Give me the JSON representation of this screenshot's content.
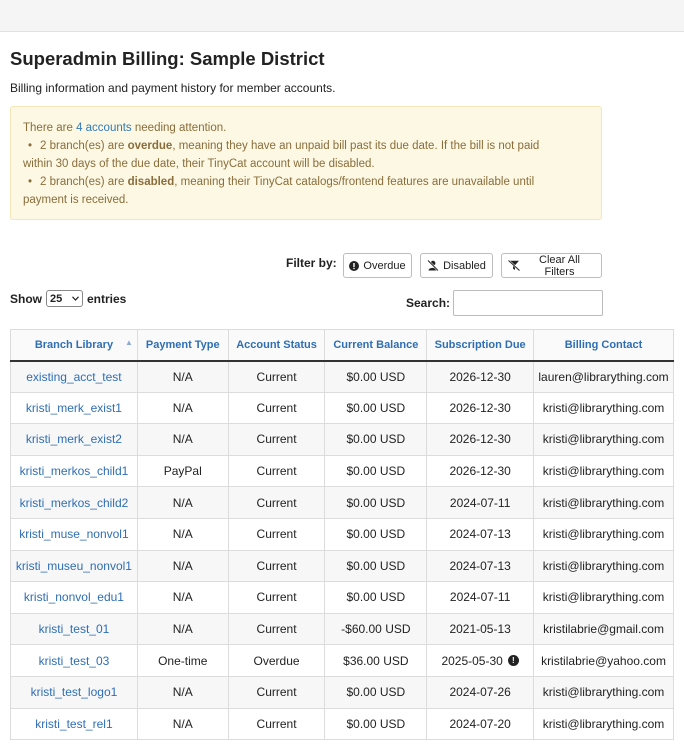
{
  "page": {
    "title": "Superadmin Billing: Sample District",
    "subtitle": "Billing information and payment history for member accounts."
  },
  "alert": {
    "intro_before": "There are ",
    "accounts_link": "4 accounts",
    "intro_after": " needing attention.",
    "overdue_count": "2 branch(es) are ",
    "overdue_word": "overdue",
    "overdue_rest_line1": ", meaning they have an unpaid bill past its due date. If the bill is not paid",
    "overdue_rest_line2": "within 30 days of the due date, their TinyCat account will be disabled.",
    "disabled_count": "2 branch(es) are ",
    "disabled_word": "disabled",
    "disabled_rest_line1": ", meaning their TinyCat catalogs/frontend features are unavailable until",
    "disabled_rest_line2": "payment is received."
  },
  "filters": {
    "label": "Filter by:",
    "overdue": "Overdue",
    "disabled": "Disabled",
    "clear": "Clear All Filters"
  },
  "entries": {
    "show": "Show",
    "value": "25",
    "suffix": "entries"
  },
  "search": {
    "label": "Search:",
    "value": ""
  },
  "table": {
    "headers": [
      "Branch Library",
      "Payment Type",
      "Account Status",
      "Current Balance",
      "Subscription Due",
      "Billing Contact"
    ],
    "rows": [
      {
        "branch": "existing_acct_test",
        "payment": "N/A",
        "status": "Current",
        "balance": "$0.00 USD",
        "due": "2026-12-30",
        "contact": "lauren@librarything.com"
      },
      {
        "branch": "kristi_merk_exist1",
        "payment": "N/A",
        "status": "Current",
        "balance": "$0.00 USD",
        "due": "2026-12-30",
        "contact": "kristi@librarything.com"
      },
      {
        "branch": "kristi_merk_exist2",
        "payment": "N/A",
        "status": "Current",
        "balance": "$0.00 USD",
        "due": "2026-12-30",
        "contact": "kristi@librarything.com"
      },
      {
        "branch": "kristi_merkos_child1",
        "payment": "PayPal",
        "status": "Current",
        "balance": "$0.00 USD",
        "due": "2026-12-30",
        "contact": "kristi@librarything.com"
      },
      {
        "branch": "kristi_merkos_child2",
        "payment": "N/A",
        "status": "Current",
        "balance": "$0.00 USD",
        "due": "2024-07-11",
        "contact": "kristi@librarything.com"
      },
      {
        "branch": "kristi_muse_nonvol1",
        "payment": "N/A",
        "status": "Current",
        "balance": "$0.00 USD",
        "due": "2024-07-13",
        "contact": "kristi@librarything.com"
      },
      {
        "branch": "kristi_museu_nonvol1",
        "payment": "N/A",
        "status": "Current",
        "balance": "$0.00 USD",
        "due": "2024-07-13",
        "contact": "kristi@librarything.com"
      },
      {
        "branch": "kristi_nonvol_edu1",
        "payment": "N/A",
        "status": "Current",
        "balance": "$0.00 USD",
        "due": "2024-07-11",
        "contact": "kristi@librarything.com"
      },
      {
        "branch": "kristi_test_01",
        "payment": "N/A",
        "status": "Current",
        "balance": "-$60.00 USD",
        "due": "2021-05-13",
        "contact": "kristilabrie@gmail.com"
      },
      {
        "branch": "kristi_test_03",
        "payment": "One-time",
        "status": "Overdue",
        "balance": "$36.00 USD",
        "due": "2025-05-30",
        "contact": "kristilabrie@yahoo.com",
        "warning": "!"
      },
      {
        "branch": "kristi_test_logo1",
        "payment": "N/A",
        "status": "Current",
        "balance": "$0.00 USD",
        "due": "2024-07-26",
        "contact": "kristi@librarything.com"
      },
      {
        "branch": "kristi_test_rel1",
        "payment": "N/A",
        "status": "Current",
        "balance": "$0.00 USD",
        "due": "2024-07-20",
        "contact": "kristi@librarything.com"
      }
    ]
  }
}
